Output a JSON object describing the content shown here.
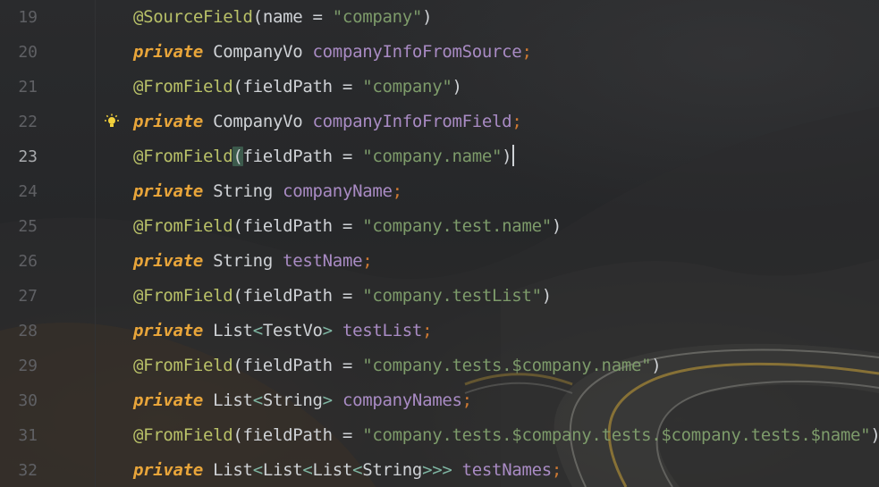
{
  "editor": {
    "current_line": "23",
    "lines": [
      {
        "num": "19",
        "annotation": "@SourceField",
        "open": "(",
        "param": "name",
        "eq": " = ",
        "value": "\"company\"",
        "close": ")"
      },
      {
        "num": "20",
        "kw": "private",
        "type": "CompanyVo",
        "name": "companyInfoFromSource",
        "semi": ";"
      },
      {
        "num": "21",
        "annotation": "@FromField",
        "open": "(",
        "param": "fieldPath",
        "eq": " = ",
        "value": "\"company\"",
        "close": ")"
      },
      {
        "num": "22",
        "kw": "private",
        "type": "CompanyVo",
        "name": "companyInfoFromField",
        "semi": ";"
      },
      {
        "num": "23",
        "annotation": "@FromField",
        "open": "(",
        "param": "fieldPath",
        "eq": " = ",
        "value": "\"company.name\"",
        "close": ")"
      },
      {
        "num": "24",
        "kw": "private",
        "type": "String",
        "name": "companyName",
        "semi": ";"
      },
      {
        "num": "25",
        "annotation": "@FromField",
        "open": "(",
        "param": "fieldPath",
        "eq": " = ",
        "value": "\"company.test.name\"",
        "close": ")"
      },
      {
        "num": "26",
        "kw": "private",
        "type": "String",
        "name": "testName",
        "semi": ";"
      },
      {
        "num": "27",
        "annotation": "@FromField",
        "open": "(",
        "param": "fieldPath",
        "eq": " = ",
        "value": "\"company.testList\"",
        "close": ")"
      },
      {
        "num": "28",
        "kw": "private",
        "type": "List",
        "lt": "<",
        "inner": "TestVo",
        "gt": ">",
        "name": "testList",
        "semi": ";"
      },
      {
        "num": "29",
        "annotation": "@FromField",
        "open": "(",
        "param": "fieldPath",
        "eq": " = ",
        "value": "\"company.tests.$company.name\"",
        "close": ")"
      },
      {
        "num": "30",
        "kw": "private",
        "type": "List",
        "lt": "<",
        "inner": "String",
        "gt": ">",
        "name": "companyNames",
        "semi": ";"
      },
      {
        "num": "31",
        "annotation": "@FromField",
        "open": "(",
        "param": "fieldPath",
        "eq": " = ",
        "value": "\"company.tests.$company.tests.$company.tests.$name\"",
        "close": ")"
      },
      {
        "num": "32",
        "kw": "private",
        "type": "List",
        "lt1": "<",
        "t2": "List",
        "lt2": "<",
        "t3": "List",
        "lt3": "<",
        "inner": "String",
        "gts": ">>>",
        "name": "testNames",
        "semi": ";"
      }
    ],
    "icons": {
      "intention": "lightbulb-icon"
    },
    "colors": {
      "background": "#262729",
      "keyword": "#e8a53a",
      "annotation": "#b9c168",
      "string": "#7d9b6a",
      "field": "#a98bc4",
      "text": "#cfd2d6",
      "line_number": "#5f6064"
    }
  }
}
